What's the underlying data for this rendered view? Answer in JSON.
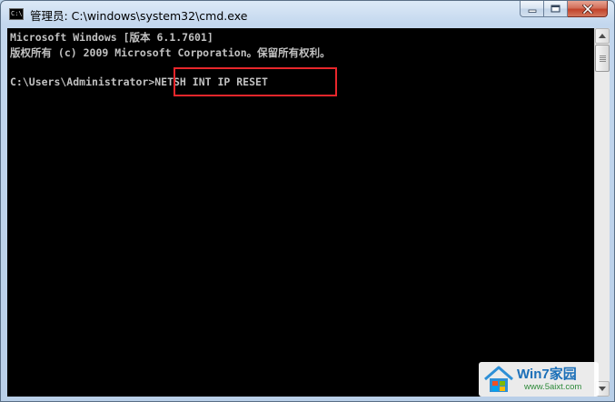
{
  "window": {
    "title": "管理员: C:\\windows\\system32\\cmd.exe",
    "icon": "cmd-app-icon",
    "icon_text": "C:\\",
    "buttons": {
      "minimize": "minimize-icon",
      "maximize": "maximize-icon",
      "close": "close-icon"
    }
  },
  "console": {
    "lines": [
      "Microsoft Windows [版本 6.1.7601]",
      "版权所有 (c) 2009 Microsoft Corporation。保留所有权利。",
      "",
      "C:\\Users\\Administrator>NETSH INT IP RESET"
    ],
    "highlight_color": "#e8262b"
  },
  "watermark": {
    "brand": "Win7家园",
    "url": "www.5aixt.com"
  }
}
